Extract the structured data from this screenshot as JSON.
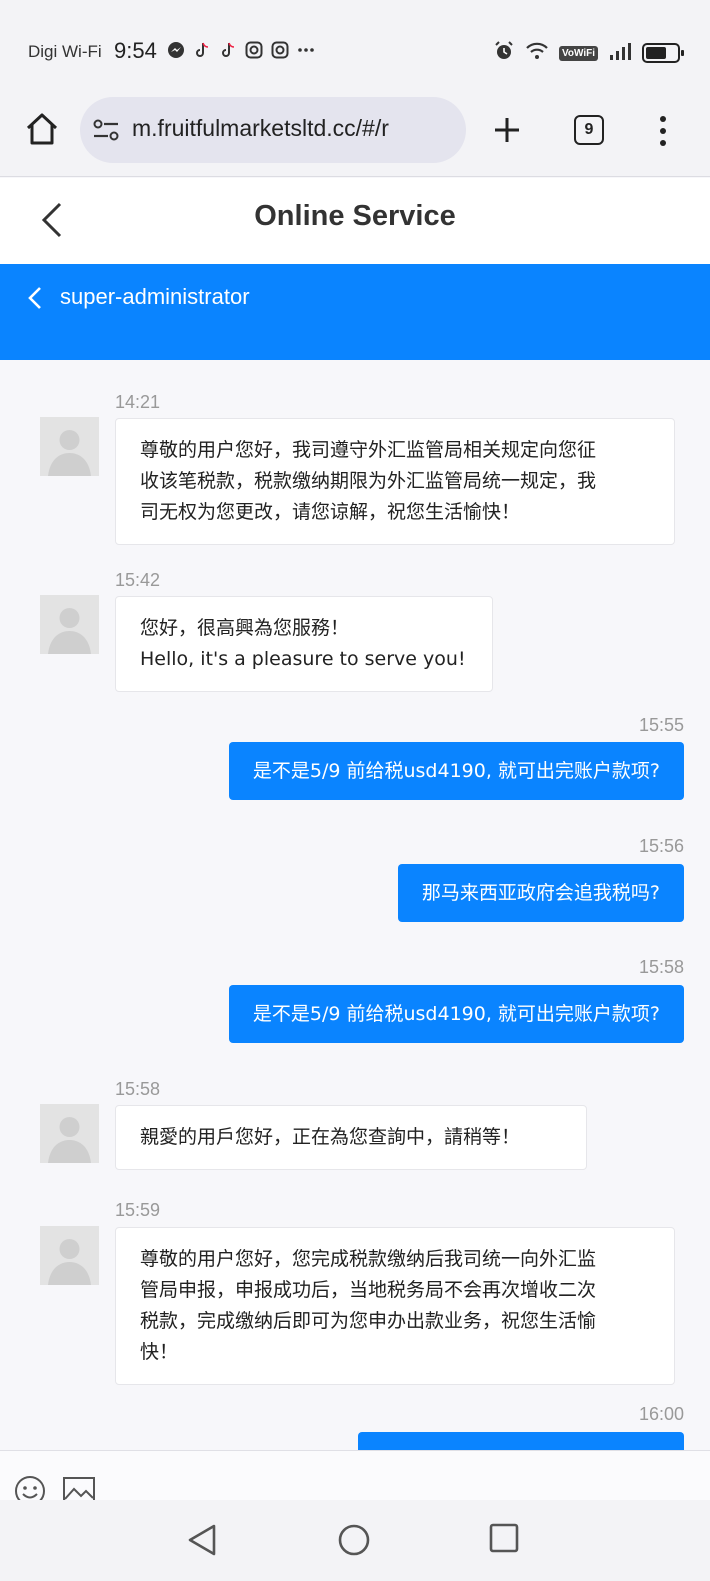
{
  "status_bar": {
    "carrier": "Digi Wi-Fi",
    "time": "9:54",
    "notifications": [
      "messenger-icon",
      "tiktok-icon",
      "tiktok-icon",
      "instagram-icon",
      "instagram-icon",
      "more-dots-icon"
    ],
    "vowifi_label": "VoWiFi"
  },
  "browser": {
    "url": "m.fruitfulmarketsltd.cc/#/r",
    "tab_count": "9"
  },
  "header": {
    "title": "Online Service"
  },
  "agent_bar": {
    "name": "super-administrator"
  },
  "messages": [
    {
      "dir": "in",
      "time": "14:21",
      "lines": [
        "尊敬的用户您好，我司遵守外汇监管局相关规定向您征",
        "收该笔税款，税款缴纳期限为外汇监管局统一规定，我",
        "司无权为您更改，请您谅解，祝您生活愉快！"
      ]
    },
    {
      "dir": "in",
      "time": "15:42",
      "lines": [
        "您好，很高興為您服務！",
        "Hello, it's a pleasure to serve you!"
      ]
    },
    {
      "dir": "out",
      "time": "15:55",
      "text": "是不是5/9 前给税usd4190, 就可出完账户款项?"
    },
    {
      "dir": "out",
      "time": "15:56",
      "text": "那马来西亚政府会追我税吗?"
    },
    {
      "dir": "out",
      "time": "15:58",
      "text": "是不是5/9 前给税usd4190, 就可出完账户款项?"
    },
    {
      "dir": "in",
      "time": "15:58",
      "lines": [
        "親愛的用戶您好，正在為您查詢中，請稍等！"
      ]
    },
    {
      "dir": "in",
      "time": "15:59",
      "lines": [
        "尊敬的用户您好，您完成税款缴纳后我司统一向外汇监",
        "管局申报，申报成功后，当地税务局不会再次增收二次",
        "税款，完成缴纳后即可为您申办出款业务，祝您生活愉",
        "快！"
      ]
    },
    {
      "dir": "out",
      "time": "16:00",
      "text": ""
    }
  ],
  "colors": {
    "accent": "#0a84ff",
    "bubble_in_bg": "#ffffff",
    "page_bg": "#f7f7fa"
  }
}
